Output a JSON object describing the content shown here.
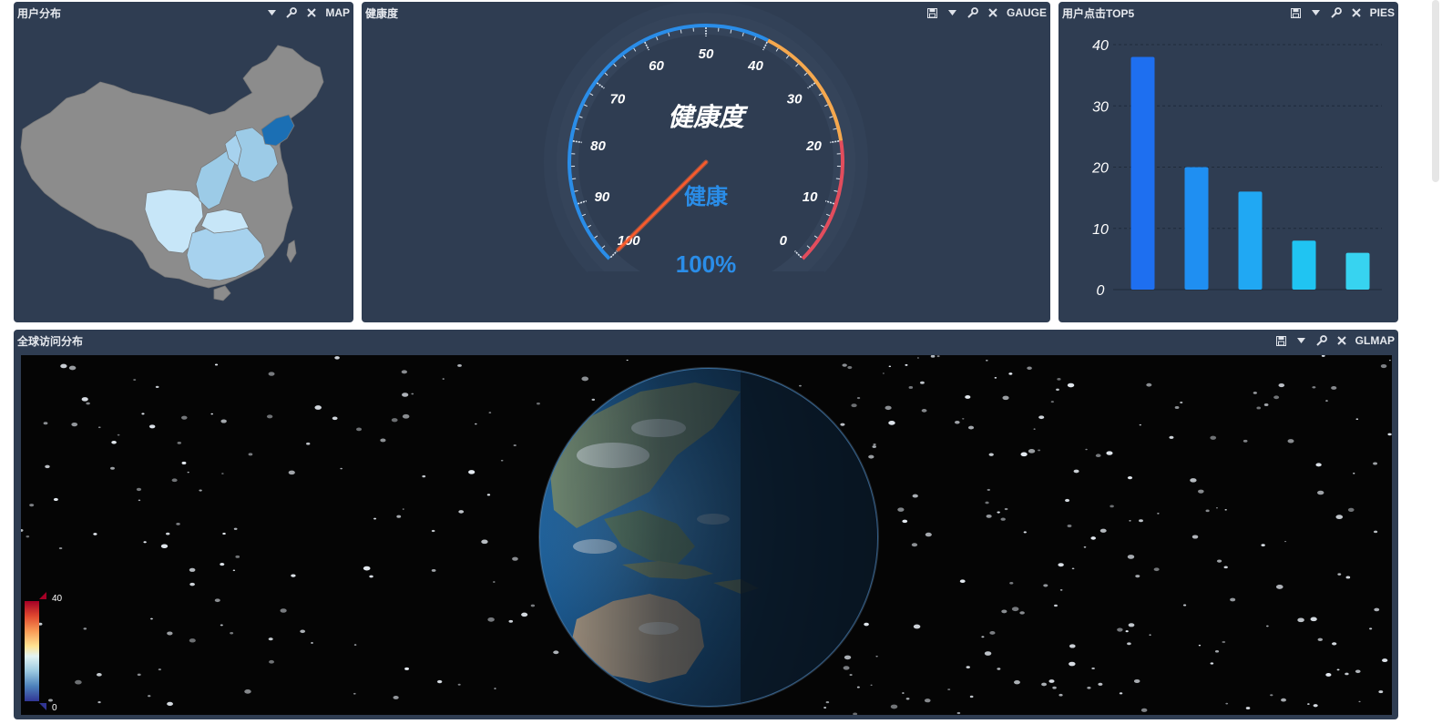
{
  "panels": {
    "map": {
      "title": "用户分布",
      "type_label": "MAP"
    },
    "gauge": {
      "title": "健康度",
      "type_label": "GAUGE"
    },
    "bar": {
      "title": "用户点击TOP5",
      "type_label": "PIES"
    },
    "globe": {
      "title": "全球访问分布",
      "type_label": "GLMAP"
    }
  },
  "toolbar_icons": {
    "save": "save-icon",
    "dropdown": "caret-down-icon",
    "settings": "wrench-icon",
    "close": "close-icon"
  },
  "gauge": {
    "center_label": "健康度",
    "status_text": "健康",
    "value_text": "100%",
    "value": 100,
    "min": 0,
    "max": 100,
    "ticks": [
      "0",
      "10",
      "20",
      "30",
      "40",
      "50",
      "60",
      "70",
      "80",
      "90",
      "100"
    ],
    "colors": {
      "healthy": "#2a8de8",
      "warning": "#f5a84e",
      "danger": "#e24d5d"
    }
  },
  "chart_data": {
    "type": "bar",
    "categories": [
      "",
      "",
      "",
      "",
      ""
    ],
    "values": [
      38,
      20,
      16,
      8,
      6
    ],
    "ylim": [
      0,
      40
    ],
    "yticks": [
      "0",
      "10",
      "20",
      "30",
      "40"
    ],
    "grid": true,
    "colors": [
      "#1e6ff0",
      "#1f8ff2",
      "#20a8f3",
      "#20c4f2",
      "#37d3f0"
    ]
  },
  "map": {
    "colors": {
      "default": "#8c8c8c",
      "low": "#c7e6f8",
      "mid": "#9ccbe7",
      "high": "#1b6fb4"
    }
  },
  "globe": {
    "legend_max": "40",
    "legend_min": "0"
  },
  "colors": {
    "panel_bg": "#2f3d52",
    "page_bg": "#ffffff"
  }
}
